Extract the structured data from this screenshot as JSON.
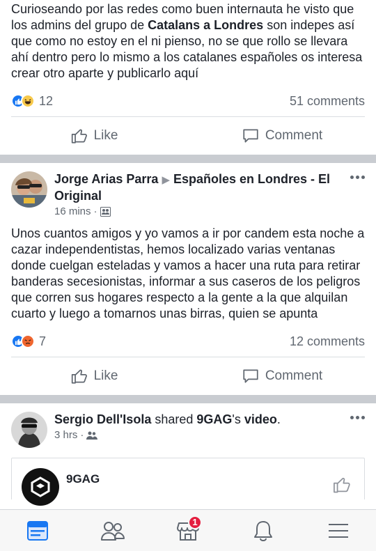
{
  "post1": {
    "text_before": "Curioseando por las redes como buen internauta he visto que los admins del grupo de ",
    "text_bold": "Catalans a Londres",
    "text_after": " son indepes así que como no estoy en el ni pienso, no se que rollo se llevara ahí dentro pero lo mismo a los catalanes españoles os interesa crear otro aparte y publicarlo aquí",
    "reactions": [
      "like",
      "haha"
    ],
    "reaction_count": "12",
    "comments": "51 comments",
    "like_label": "Like",
    "comment_label": "Comment"
  },
  "post2": {
    "author": "Jorge Arias Parra",
    "arrow": "▶",
    "group": "Españoles en Londres - El Original",
    "time": "16 mins",
    "dot": "·",
    "text": "Unos cuantos amigos y yo vamos a ir por candem esta noche a cazar independentistas, hemos localizado varias ventanas donde cuelgan esteladas y vamos a hacer una ruta para retirar banderas secesionistas, informar a sus caseros de los peligros que corren sus hogares respecto a la gente a la que alquilan cuarto  y luego a tomarnos unas birras, quien se apunta",
    "reactions": [
      "like",
      "angry"
    ],
    "reaction_count": "7",
    "comments": "12 comments",
    "like_label": "Like",
    "comment_label": "Comment"
  },
  "post3": {
    "author": "Sergio Dell'Isola",
    "shared_word": " shared ",
    "page": "9GAG",
    "possessive": "'s ",
    "object": "video",
    "period": ".",
    "time": "3 hrs",
    "dot": "·",
    "shared_page_name": "9GAG"
  },
  "tabbar": {
    "notifications_badge": "1"
  },
  "colors": {
    "accent": "#1877f2",
    "badge": "#e41e3f",
    "separator": "#c9ccd1"
  }
}
